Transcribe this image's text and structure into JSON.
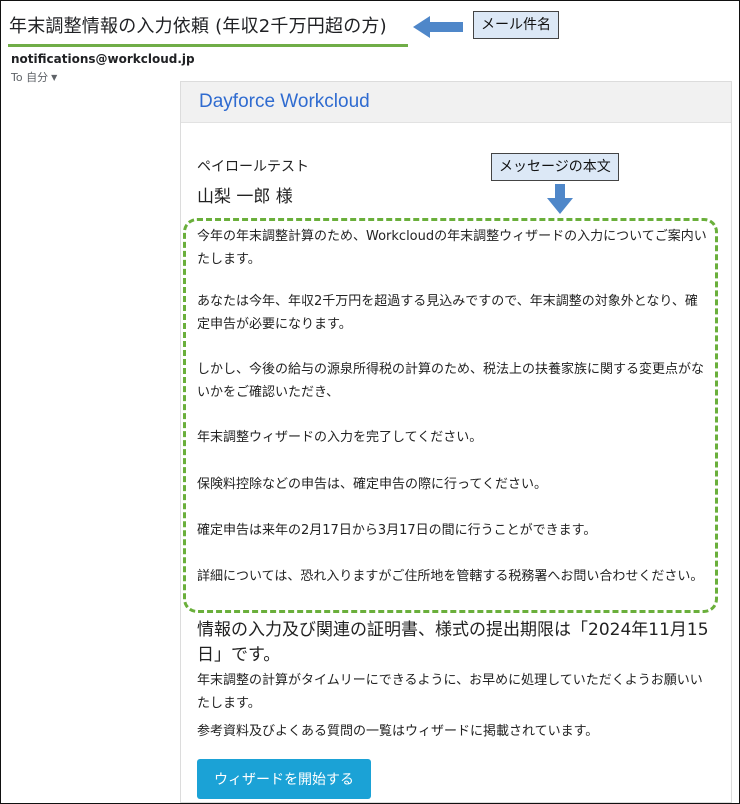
{
  "email": {
    "subject": "年末調整情報の入力依頼 (年収2千万円超の方)",
    "sender": "notifications@workcloud.jp",
    "to_label": "To 自分",
    "to_caret": "▼"
  },
  "annotations": {
    "subject_callout": "メール件名",
    "body_callout": "メッセージの本文"
  },
  "message": {
    "brand": "Dayforce Workcloud",
    "company": "ペイロールテスト",
    "recipient": "山梨 一郎 様",
    "paragraphs": [
      "今年の年末調整計算のため、Workcloudの年末調整ウィザードの入力についてご案内いたします。",
      "あなたは今年、年収2千万円を超過する見込みですので、年末調整の対象外となり、確定申告が必要になります。",
      "しかし、今後の給与の源泉所得税の計算のため、税法上の扶養家族に関する変更点がないかをご確認いただき、",
      "年末調整ウィザードの入力を完了してください。",
      "保険料控除などの申告は、確定申告の際に行ってください。",
      "確定申告は来年の2月17日から3月17日の間に行うことができます。",
      "詳細については、恐れ入りますがご住所地を管轄する税務署へお問い合わせください。"
    ],
    "deadline": "情報の入力及び関連の証明書、様式の提出期限は「2024年11月15日」です。",
    "request": "年末調整の計算がタイムリーにできるように、お早めに処理していただくようお願いいたします。",
    "reference": "参考資料及びよくある質問の一覧はウィザードに掲載されています。",
    "button_label": "ウィザードを開始する"
  },
  "colors": {
    "brand": "#2f6bd0",
    "highlight_green": "#70ad47",
    "callout_bg": "#dce8f6",
    "arrow_blue": "#4f87c9",
    "button": "#1ba2d6"
  }
}
